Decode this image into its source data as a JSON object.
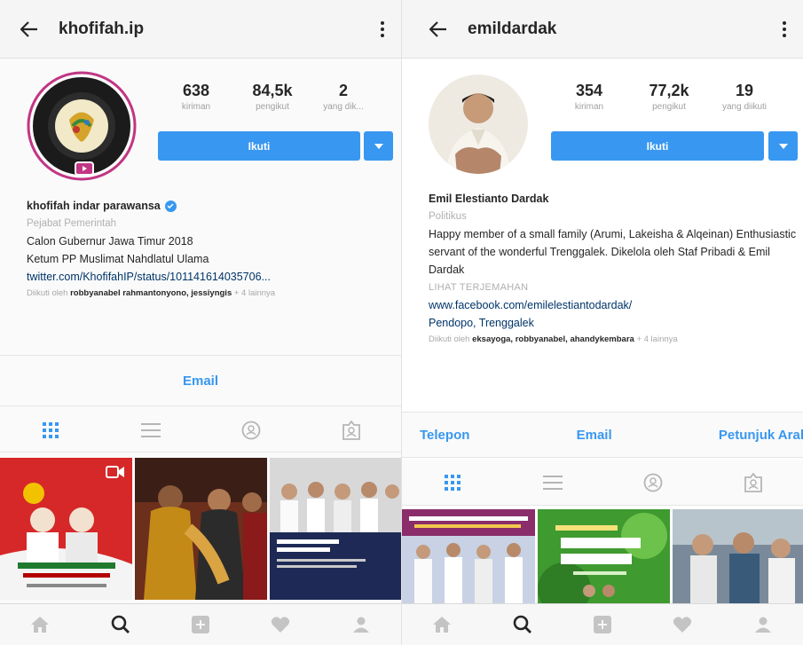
{
  "colors": {
    "accent": "#3897f0",
    "text": "#262626",
    "muted": "#a0a0a0",
    "link": "#003569",
    "story_ring": "#c13584"
  },
  "left": {
    "username": "khofifah.ip",
    "stats": [
      {
        "value": "638",
        "label": "kiriman"
      },
      {
        "value": "84,5k",
        "label": "pengikut"
      },
      {
        "value": "2",
        "label": "yang dik..."
      }
    ],
    "follow_label": "Ikuti",
    "bio": {
      "name": "khofifah indar parawansa",
      "category": "Pejabat Pemerintah",
      "line1": "Calon Gubernur Jawa Timur 2018",
      "line2": "Ketum PP Muslimat Nahdlatul Ulama",
      "link": "twitter.com/KhofifahIP/status/101141614035706...",
      "followed_prefix": "Diikuti oleh ",
      "followed_names": "robbyanabel rahmantonyono, jessiyngis",
      "followed_suffix": " + 4 lainnya"
    },
    "actions": [
      "Email"
    ],
    "tabs": [
      "grid-icon",
      "list-icon",
      "tagged-icon",
      "saved-tag-icon"
    ],
    "nav": [
      "home-icon",
      "search-icon",
      "add-icon",
      "heart-icon",
      "profile-icon"
    ]
  },
  "right": {
    "username": "emildardak",
    "stats": [
      {
        "value": "354",
        "label": "kiriman"
      },
      {
        "value": "77,2k",
        "label": "pengikut"
      },
      {
        "value": "19",
        "label": "yang diikuti"
      }
    ],
    "follow_label": "Ikuti",
    "bio": {
      "name": "Emil Elestianto Dardak",
      "category": "Politikus",
      "text": "Happy member of a small family (Arumi, Lakeisha & Alqeinan) Enthusiastic servant of the wonderful Trenggalek. Dikelola oleh Staf Pribadi & Emil Dardak",
      "translate": "LIHAT TERJEMAHAN",
      "link": "www.facebook.com/emilelestiantodardak/",
      "location": "Pendopo, Trenggalek",
      "followed_prefix": "Diikuti oleh ",
      "followed_names": "eksayoga, robbyanabel, ahandykembara",
      "followed_suffix": " + 4 lainnya"
    },
    "actions": [
      "Telepon",
      "Email",
      "Petunjuk Arah"
    ],
    "tabs": [
      "grid-icon",
      "list-icon",
      "tagged-icon",
      "saved-tag-icon"
    ],
    "nav": [
      "home-icon",
      "search-icon",
      "add-icon",
      "heart-icon",
      "profile-icon"
    ]
  }
}
